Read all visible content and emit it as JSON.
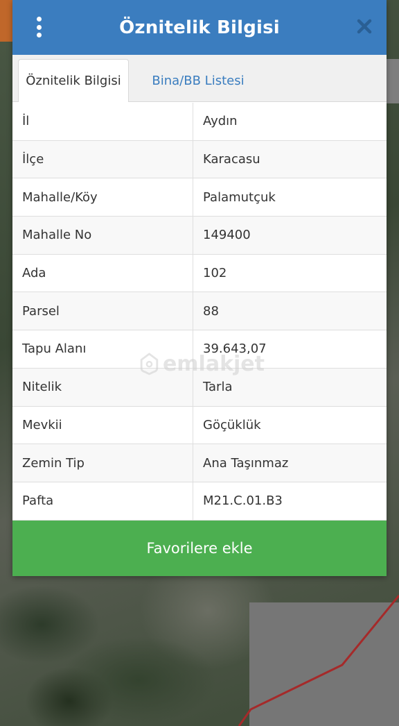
{
  "header": {
    "title": "Öznitelik Bilgisi",
    "menu_icon": "more-vertical-icon",
    "close_icon": "close-icon"
  },
  "tabs": [
    {
      "label": "Öznitelik Bilgisi",
      "active": true
    },
    {
      "label": "Bina/BB Listesi",
      "active": false
    }
  ],
  "rows": [
    {
      "key": "İl",
      "value": "Aydın"
    },
    {
      "key": "İlçe",
      "value": "Karacasu"
    },
    {
      "key": "Mahalle/Köy",
      "value": "Palamutçuk"
    },
    {
      "key": "Mahalle No",
      "value": "149400"
    },
    {
      "key": "Ada",
      "value": "102"
    },
    {
      "key": "Parsel",
      "value": "88"
    },
    {
      "key": "Tapu Alanı",
      "value": "39.643,07"
    },
    {
      "key": "Nitelik",
      "value": "Tarla"
    },
    {
      "key": "Mevkii",
      "value": "Göçüklük"
    },
    {
      "key": "Zemin Tip",
      "value": "Ana Taşınmaz"
    },
    {
      "key": "Pafta",
      "value": "M21.C.01.B3"
    }
  ],
  "favorite_button": {
    "label": "Favorilere ekle"
  },
  "watermark": {
    "text": "emlakjet"
  },
  "colors": {
    "header": "#3b7dbf",
    "tab_link": "#3a7dbf",
    "button": "#4caf50",
    "parcel_border": "#a52a2a"
  }
}
